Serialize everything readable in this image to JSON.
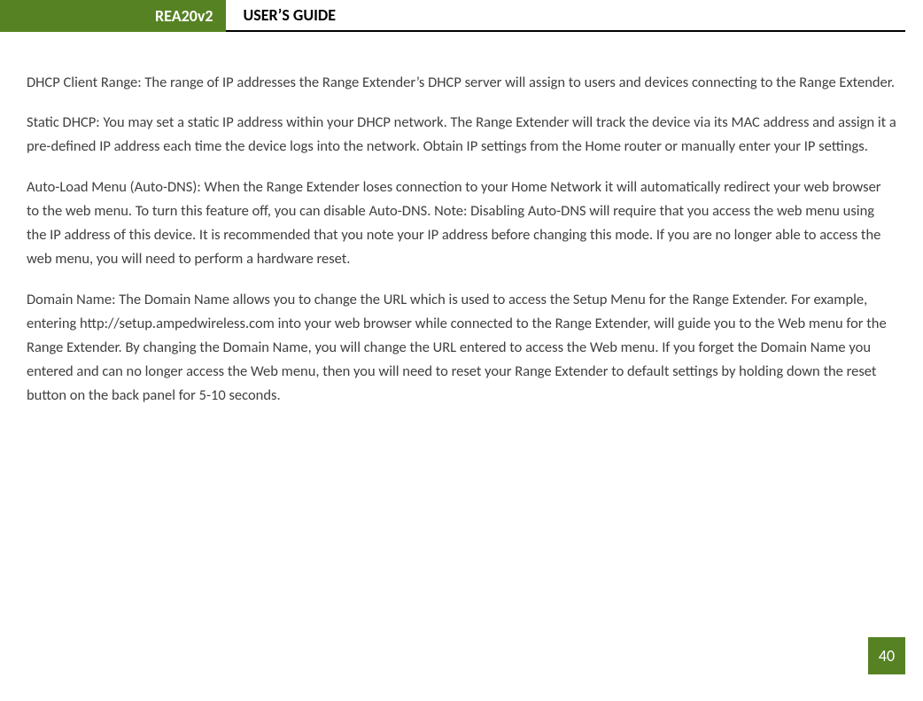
{
  "header": {
    "product": "REA20v2",
    "title": "USER’S GUIDE"
  },
  "content": {
    "p1": "DHCP Client Range: The range of IP addresses the Range Extender’s DHCP server will assign to users and devices connecting to the Range Extender.",
    "p2": "Static DHCP: You may set a static IP address within your DHCP network. The Range Extender will track the device via its MAC address and assign it a pre-defined IP address each time the device logs into the network. Obtain IP settings from the Home router or manually enter your IP settings.",
    "p3": "Auto-Load Menu (Auto-DNS): When the Range Extender loses connection to your Home Network it will automatically redirect your web browser to the web menu. To turn this feature off, you can disable Auto-DNS. Note: Disabling Auto-DNS will require that you access the web menu using the IP address of this device. It is recommended that you note your IP address before changing this mode. If you are no longer able to access the web menu, you will need to perform a hardware reset.",
    "p4": "Domain Name: The Domain Name allows you to change the URL which is used to access the Setup Menu for the Range Extender. For example, entering http://setup.ampedwireless.com into your web browser while connected to the Range Extender, will guide you to the Web menu for the Range Extender. By changing the Domain Name, you will change the URL entered to access the Web menu. If you forget the Domain Name you entered and can no longer access the Web menu, then you will need to reset your Range Extender to default settings by holding down the reset button on the back panel for 5-10 seconds."
  },
  "page_number": "40"
}
